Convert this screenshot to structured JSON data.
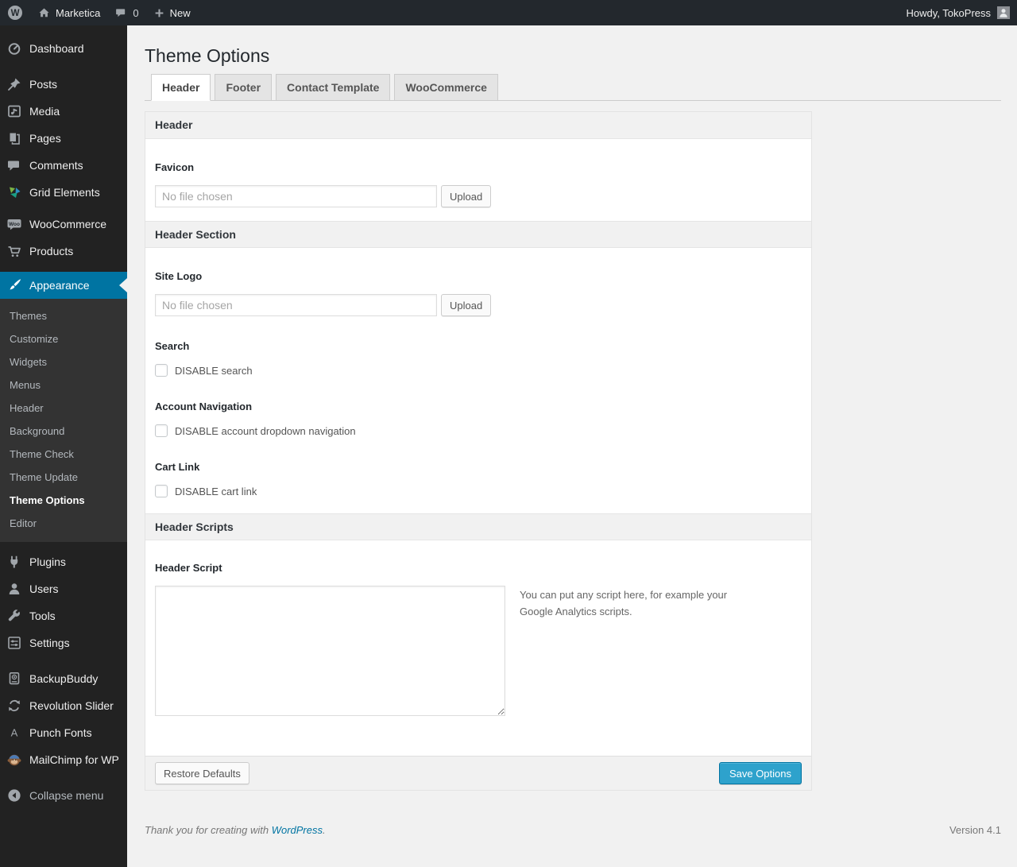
{
  "colors": {
    "menu_highlight": "#0074a2",
    "primary_button": "#2ea2cc",
    "link": "#0074a2",
    "menu_background": "#222222",
    "admin_bar_background": "#23282d"
  },
  "icons": {
    "wp_logo_letter": "W",
    "woocommerce_badge": "Woo",
    "punch_fonts_letter": "A"
  },
  "admin_bar": {
    "site_name": "Marketica",
    "comments_count": "0",
    "new_label": "New",
    "howdy": "Howdy, TokoPress"
  },
  "sidebar": {
    "items": [
      {
        "label": "Dashboard",
        "icon": "dashboard-icon"
      },
      {
        "label": "Posts",
        "icon": "pin-icon"
      },
      {
        "label": "Media",
        "icon": "media-icon"
      },
      {
        "label": "Pages",
        "icon": "pages-icon"
      },
      {
        "label": "Comments",
        "icon": "comments-icon"
      },
      {
        "label": "Grid Elements",
        "icon": "grid-elements-icon"
      },
      {
        "label": "WooCommerce",
        "icon": "woocommerce-icon"
      },
      {
        "label": "Products",
        "icon": "cart-icon"
      },
      {
        "label": "Appearance",
        "icon": "brush-icon"
      },
      {
        "label": "Plugins",
        "icon": "plug-icon"
      },
      {
        "label": "Users",
        "icon": "user-icon"
      },
      {
        "label": "Tools",
        "icon": "wrench-icon"
      },
      {
        "label": "Settings",
        "icon": "sliders-icon"
      },
      {
        "label": "BackupBuddy",
        "icon": "backup-safe-icon"
      },
      {
        "label": "Revolution Slider",
        "icon": "refresh-icon"
      },
      {
        "label": "Punch Fonts",
        "icon": "letter-a-icon"
      },
      {
        "label": "MailChimp for WP",
        "icon": "mailchimp-monkey-icon"
      }
    ],
    "submenu": [
      "Themes",
      "Customize",
      "Widgets",
      "Menus",
      "Header",
      "Background",
      "Theme Check",
      "Theme Update",
      "Theme Options",
      "Editor"
    ],
    "current_submenu": "Theme Options",
    "collapse_label": "Collapse menu"
  },
  "page": {
    "title": "Theme Options",
    "tabs": [
      {
        "label": "Header",
        "active": true
      },
      {
        "label": "Footer",
        "active": false
      },
      {
        "label": "Contact Template",
        "active": false
      },
      {
        "label": "WooCommerce",
        "active": false
      }
    ]
  },
  "form": {
    "section_header": "Header",
    "favicon": {
      "label": "Favicon",
      "placeholder": "No file chosen",
      "value": ""
    },
    "upload_label": "Upload",
    "section_header_section": "Header Section",
    "site_logo": {
      "label": "Site Logo",
      "placeholder": "No file chosen",
      "value": ""
    },
    "search": {
      "label": "Search",
      "checkbox_label": "DISABLE search",
      "checked": false
    },
    "account": {
      "label": "Account Navigation",
      "checkbox_label": "DISABLE account dropdown navigation",
      "checked": false
    },
    "cart": {
      "label": "Cart Link",
      "checkbox_label": "DISABLE cart link",
      "checked": false
    },
    "section_header_scripts": "Header Scripts",
    "script": {
      "label": "Header Script",
      "value": "",
      "note": "You can put any script here, for example your Google Analytics scripts."
    },
    "restore_label": "Restore Defaults",
    "save_label": "Save Options"
  },
  "footer": {
    "thanks_text": "Thank you for creating with",
    "link_text": "WordPress",
    "after_link": ".",
    "version": "Version 4.1"
  }
}
